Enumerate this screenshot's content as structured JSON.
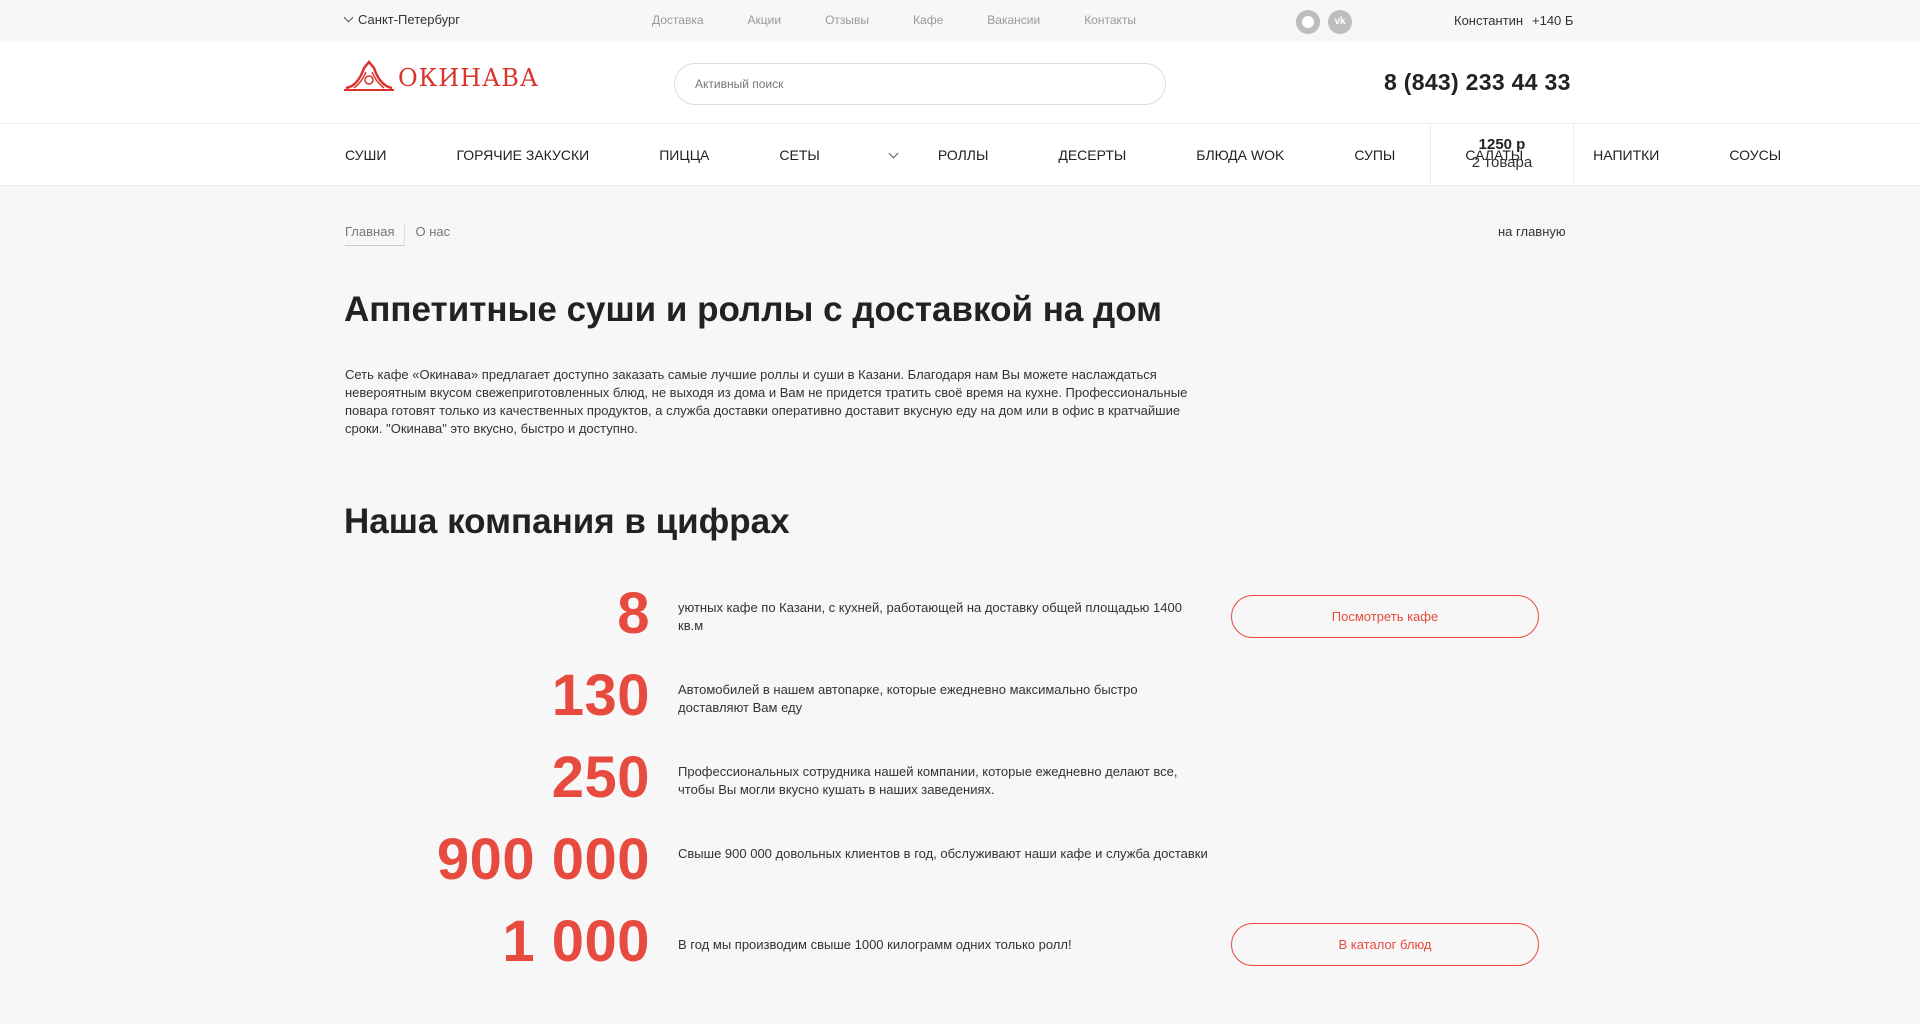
{
  "topbar": {
    "city": "Санкт-Петербург",
    "nav": [
      "Доставка",
      "Акции",
      "Отзывы",
      "Кафе",
      "Вакансии",
      "Контакты"
    ],
    "social": [
      "ok-icon",
      "vk-icon"
    ],
    "vk_glyph": "vk",
    "user": "Константин",
    "bonus": "+140 Б"
  },
  "header": {
    "logo_text": "ОКИНАВА",
    "search_placeholder": "Активный поиск",
    "phone": "8 (843) 233 44 33"
  },
  "categories": [
    "СУШИ",
    "ГОРЯЧИЕ ЗАКУСКИ",
    "ПИЦЦА",
    "СЕТЫ",
    "РОЛЛЫ",
    "ДЕСЕРТЫ",
    "БЛЮДА WOK",
    "СУПЫ",
    "САЛАТЫ",
    "НАПИТКИ",
    "СОУСЫ"
  ],
  "cart": {
    "sum": "1250 р",
    "count": "2 товара"
  },
  "breadcrumb": {
    "home": "Главная",
    "current": "О нас",
    "back_link": "на главную"
  },
  "title": "Аппетитные суши и роллы с доставкой на дом",
  "intro": "Сеть кафе «Окинава» предлагает доступно заказать самые лучшие роллы и суши в Казани. Благодаря нам Вы можете наслаждаться невероятным вкусом свежеприготовленных блюд, не выходя из дома и Вам не придется тратить своё время на кухне. Профессиональные повара готовят только из качественных продуктов, а служба доставки оперативно доставит вкусную еду на дом или в офис в кратчайшие сроки. \"Окинава\" это вкусно, быстро и доступно.",
  "stats_title": "Наша компания в цифрах",
  "stats": [
    {
      "number": "8",
      "text": "уютных кафе по Казани, с кухней, работающей на доставку общей площадью 1400 кв.м"
    },
    {
      "number": "130",
      "text": "Автомобилей в нашем автопарке, которые ежедневно максимально быстро доставляют Вам еду"
    },
    {
      "number": "250",
      "text": "Профессиональных сотрудника нашей компании, которые ежедневно делают все, чтобы Вы могли вкусно кушать в наших заведениях."
    },
    {
      "number": "900 000",
      "text": "Свыше 900 000 довольных клиентов в год, обслуживают наши кафе и служба доставки"
    },
    {
      "number": "1 000",
      "text": "В год мы производим свыше 1000 килограмм одних только ролл!"
    }
  ],
  "buttons": {
    "cafes": "Посмотреть кафе",
    "catalog": "В каталог блюд"
  },
  "accent_color": "#e74a3e"
}
